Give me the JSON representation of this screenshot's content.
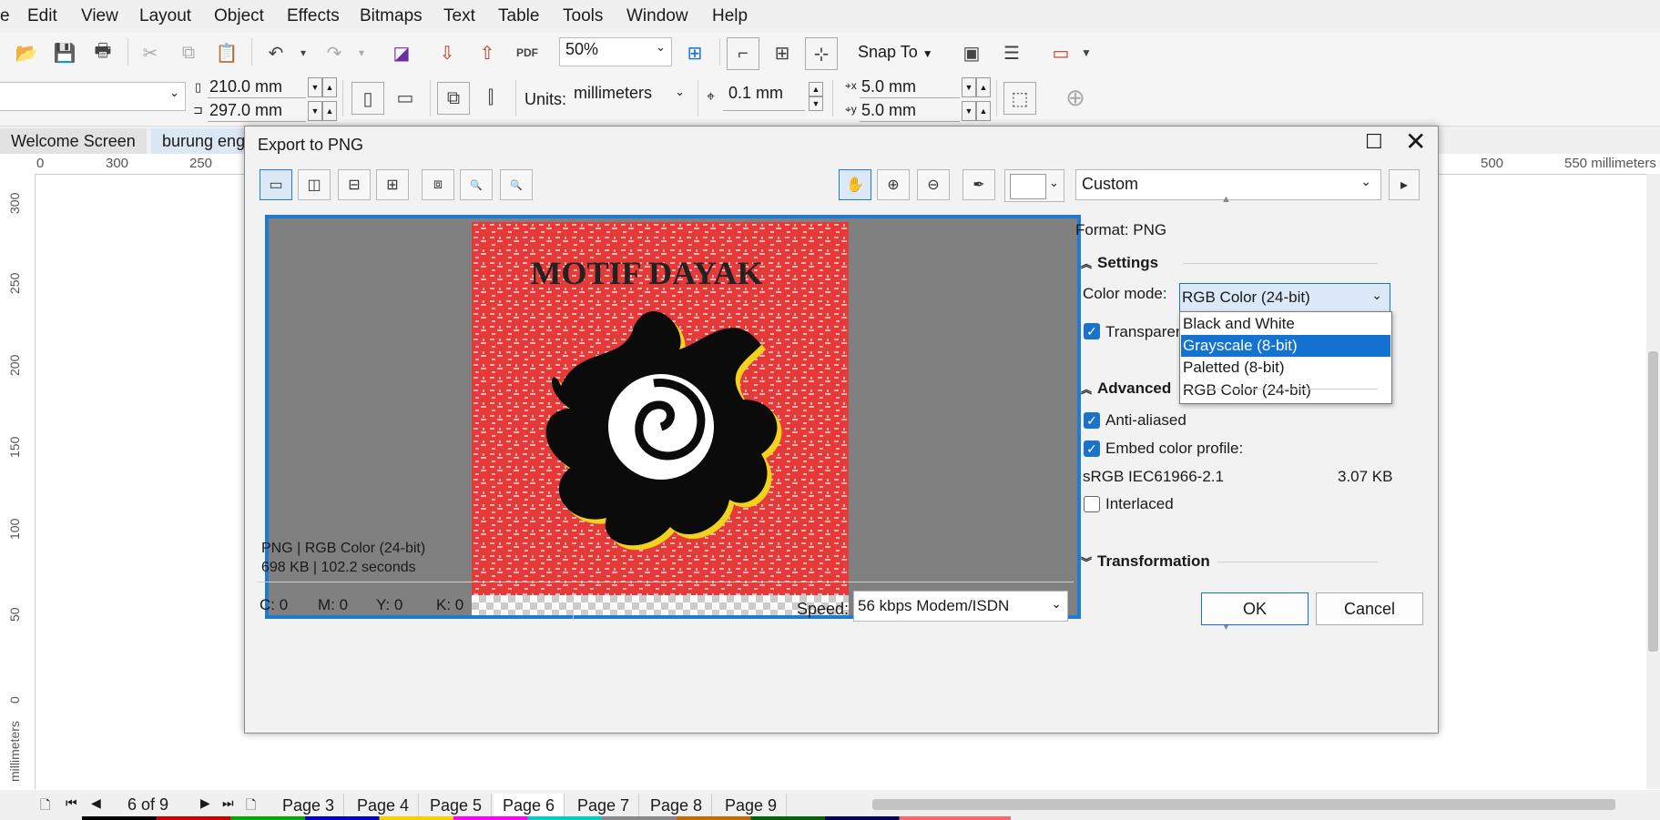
{
  "menu": [
    "e",
    "Edit",
    "View",
    "Layout",
    "Object",
    "Effects",
    "Bitmaps",
    "Text",
    "Table",
    "Tools",
    "Window",
    "Help"
  ],
  "toolbar1": {
    "zoom": "50%",
    "snap_to": "Snap To"
  },
  "toolbar2": {
    "width": "210.0 mm",
    "height": "297.0 mm",
    "units_label": "Units:",
    "units_value": "millimeters",
    "nudge": "0.1 mm",
    "dup_x": "5.0 mm",
    "dup_y": "5.0 mm"
  },
  "doc_tabs": [
    "Welcome Screen",
    "burung eng"
  ],
  "ruler": {
    "h_ticks": [
      "0",
      "300",
      "250",
      "500",
      "550 millimeters"
    ],
    "v_ticks": [
      "300",
      "250",
      "200",
      "150",
      "100",
      "50",
      "0",
      "millimeters"
    ]
  },
  "page_bar": {
    "counter": "6 of 9",
    "pages": [
      "Page 3",
      "Page 4",
      "Page 5",
      "Page 6",
      "Page 7",
      "Page 8",
      "Page 9"
    ],
    "active": "Page 6"
  },
  "dialog": {
    "title": "Export to PNG",
    "preset": "Custom",
    "format_label": "Format:",
    "format_value": "PNG",
    "settings_header": "Settings",
    "color_mode_label": "Color mode:",
    "color_mode_value": "RGB Color (24-bit)",
    "color_mode_options": [
      "Black and White",
      "Grayscale (8-bit)",
      "Paletted (8-bit)",
      "RGB Color (24-bit)"
    ],
    "highlighted_option": "Grayscale (8-bit)",
    "transparent_label": "Transparen",
    "advanced_header": "Advanced",
    "anti_aliased": "Anti-aliased",
    "embed_profile": "Embed color profile:",
    "profile_name": "sRGB IEC61966-2.1",
    "profile_size": "3.07 KB",
    "interlaced": "Interlaced",
    "transformation_header": "Transformation",
    "preview_info_line1": "PNG  |  RGB Color (24-bit)",
    "preview_info_line2": "698 KB  |  102.2 seconds",
    "preview_artwork_text": "MOTIF DAYAK",
    "cmyk": {
      "c": "C: 0",
      "m": "M: 0",
      "y": "Y: 0",
      "k": "K: 0"
    },
    "speed_label": "Speed:",
    "speed_value": "56 kbps Modem/ISDN",
    "ok": "OK",
    "cancel": "Cancel"
  },
  "colors": {
    "accent": "#1372d2",
    "artwork_red": "#e53a3a",
    "preview_bg": "#808080"
  }
}
